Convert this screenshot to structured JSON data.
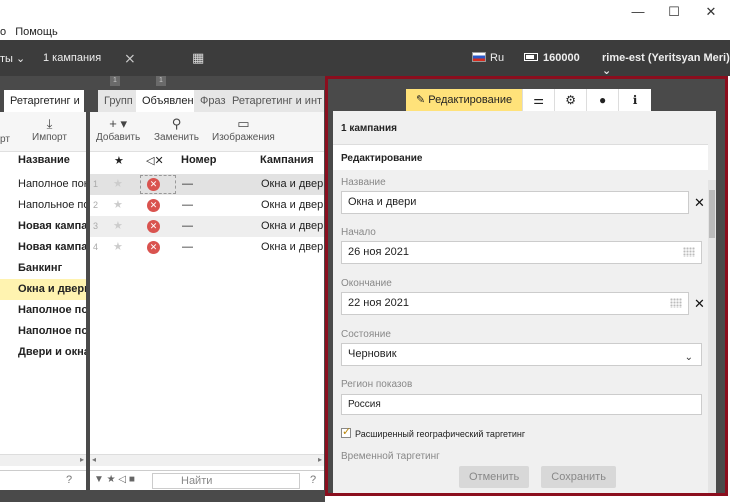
{
  "menu": {
    "items": [
      "о",
      "Помощь"
    ]
  },
  "window": {
    "minimize": "—",
    "maximize": "☐",
    "close": "✕"
  },
  "topbar": {
    "dropdown_label": "ты ⌄",
    "campaign_count": "1 кампания",
    "lang": "Ru",
    "balance": "160000",
    "account": "rime-est (Yeritsyan Meri) ⌄"
  },
  "left_panel": {
    "tab": "Ретаргетинг и",
    "tools": [
      {
        "label": "рт",
        "icon": ""
      },
      {
        "label": "Импорт",
        "icon": "⤓"
      }
    ],
    "column_header": "Название",
    "rows": [
      {
        "text": "Наполное покр",
        "bold": false,
        "selected": false
      },
      {
        "text": "Напольное пок",
        "bold": false,
        "selected": false
      },
      {
        "text": "Новая кампан",
        "bold": true,
        "selected": false
      },
      {
        "text": "Новая кампан",
        "bold": true,
        "selected": false
      },
      {
        "text": "Банкинг",
        "bold": true,
        "selected": false
      },
      {
        "text": "Окна и двери",
        "bold": true,
        "selected": true
      },
      {
        "text": "Наполное пок",
        "bold": true,
        "selected": false
      },
      {
        "text": "Наполное пок",
        "bold": true,
        "selected": false
      },
      {
        "text": "Двери и окна",
        "bold": true,
        "selected": false
      }
    ],
    "help": "?"
  },
  "mid_panel": {
    "tabs": [
      "Групп",
      "Объявлен",
      "Фраз",
      "Ретаргетинг и инт"
    ],
    "tools": [
      {
        "label": "Добавить",
        "icon": "+ ▾"
      },
      {
        "label": "Заменить",
        "icon": "⚲"
      },
      {
        "label": "Изображения",
        "icon": "▭"
      }
    ],
    "headers": {
      "star": "★",
      "status": "◁✕",
      "number": "Номер",
      "campaign": "Кампания"
    },
    "rows": [
      {
        "n": "1",
        "number": "—",
        "campaign": "Окна и двери"
      },
      {
        "n": "2",
        "number": "—",
        "campaign": "Окна и двери"
      },
      {
        "n": "3",
        "number": "—",
        "campaign": "Окна и двери"
      },
      {
        "n": "4",
        "number": "—",
        "campaign": "Окна и двери"
      }
    ],
    "filter_icons": "▼ ★ ◁ ■",
    "search_placeholder": "Найти",
    "help": "?"
  },
  "edit_panel": {
    "tabs": {
      "edit_label": "Редактирование",
      "edit_icon": "✎",
      "settings_icon": "⚙",
      "sliders_icon": "⚌",
      "comment_icon": "●",
      "info_icon": "ℹ"
    },
    "header": "1 кампания",
    "section": "Редактирование",
    "fields": {
      "name_label": "Название",
      "name_value": "Окна и двери",
      "start_label": "Начало",
      "start_value": "26 ноя 2021",
      "end_label": "Окончание",
      "end_value": "22 ноя 2021",
      "state_label": "Состояние",
      "state_value": "Черновик",
      "region_label": "Регион показов",
      "region_value": "Россия",
      "geo_checkbox": "Расширенный географический таргетинг",
      "time_label": "Временной таргетинг"
    },
    "buttons": {
      "cancel": "Отменить",
      "save": "Сохранить"
    }
  }
}
